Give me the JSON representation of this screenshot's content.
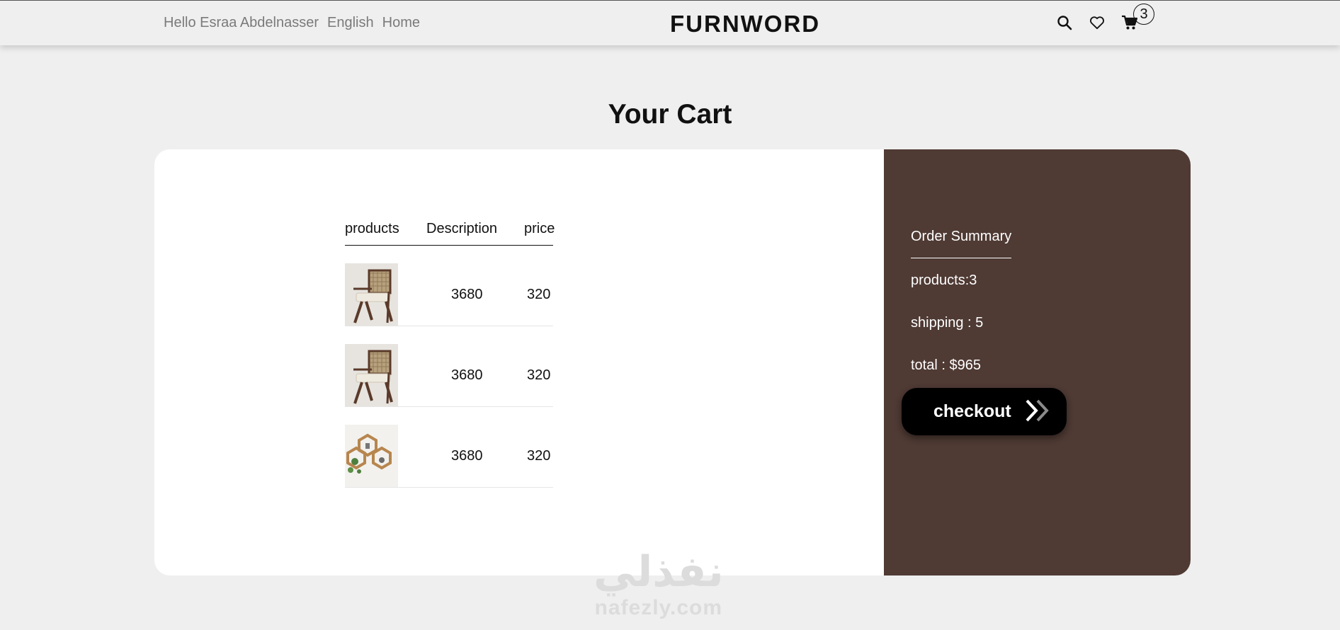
{
  "header": {
    "greeting": "Hello Esraa Abdelnasser",
    "language": "English",
    "home": "Home",
    "brand": "FURNWORD",
    "cart_count": "3",
    "icons": [
      "search-icon",
      "heart-icon",
      "cart-icon"
    ]
  },
  "page": {
    "title": "Your Cart"
  },
  "table": {
    "headers": [
      "products",
      "Description",
      "price"
    ],
    "rows": [
      {
        "image": "chair-image",
        "description": "3680",
        "price": "320"
      },
      {
        "image": "chair-image",
        "description": "3680",
        "price": "320"
      },
      {
        "image": "hexagon-shelves-image",
        "description": "3680",
        "price": "320"
      }
    ]
  },
  "summary": {
    "title": "Order Summary",
    "products": "products:3",
    "shipping": "shipping : 5",
    "total": "total : $965",
    "checkout_label": "checkout"
  },
  "watermark": {
    "arabic": "نفذلي",
    "latin": "nafezly.com"
  },
  "colors": {
    "summary_bg": "#4f3a34",
    "page_bg": "#efefef",
    "card_bg": "#ffffff",
    "checkout_bg": "#000000"
  }
}
